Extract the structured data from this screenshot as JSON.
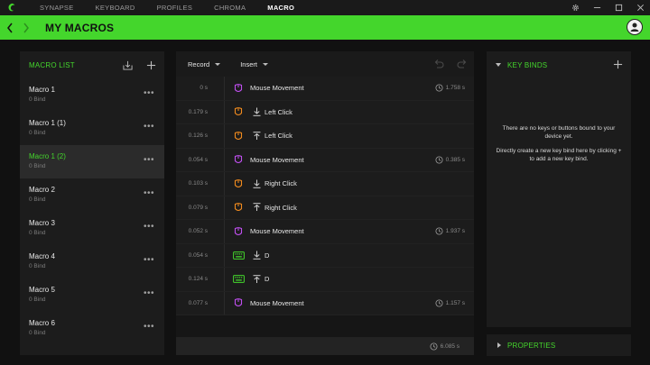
{
  "app": {
    "tabs": [
      "SYNAPSE",
      "KEYBOARD",
      "PROFILES",
      "CHROMA",
      "MACRO"
    ],
    "active_tab": "MACRO",
    "accent_color": "#44d62c"
  },
  "header": {
    "title": "MY MACROS"
  },
  "macro_list": {
    "title": "MACRO LIST",
    "items": [
      {
        "name": "Macro 1",
        "bind": "0 Bind"
      },
      {
        "name": "Macro 1 (1)",
        "bind": "0 Bind"
      },
      {
        "name": "Macro 1 (2)",
        "bind": "0 Bind",
        "selected": true
      },
      {
        "name": "Macro 2",
        "bind": "0 Bind"
      },
      {
        "name": "Macro 3",
        "bind": "0 Bind"
      },
      {
        "name": "Macro 4",
        "bind": "0 Bind"
      },
      {
        "name": "Macro 5",
        "bind": "0 Bind"
      },
      {
        "name": "Macro 6",
        "bind": "0 Bind"
      }
    ]
  },
  "editor": {
    "record_label": "Record",
    "insert_label": "Insert",
    "events": [
      {
        "delay": "0 s",
        "device": "mouse",
        "color": "#c04ff0",
        "direction": "",
        "label": "Mouse Movement",
        "duration": "1.758 s"
      },
      {
        "delay": "0.179 s",
        "device": "mouse",
        "color": "#f28b1e",
        "direction": "down",
        "label": "Left Click",
        "duration": ""
      },
      {
        "delay": "0.126 s",
        "device": "mouse",
        "color": "#f28b1e",
        "direction": "up",
        "label": "Left Click",
        "duration": ""
      },
      {
        "delay": "0.054 s",
        "device": "mouse",
        "color": "#c04ff0",
        "direction": "",
        "label": "Mouse Movement",
        "duration": "0.385 s"
      },
      {
        "delay": "0.103 s",
        "device": "mouse",
        "color": "#f28b1e",
        "direction": "down",
        "label": "Right Click",
        "duration": ""
      },
      {
        "delay": "0.079 s",
        "device": "mouse",
        "color": "#f28b1e",
        "direction": "up",
        "label": "Right Click",
        "duration": ""
      },
      {
        "delay": "0.052 s",
        "device": "mouse",
        "color": "#c04ff0",
        "direction": "",
        "label": "Mouse Movement",
        "duration": "1.937 s"
      },
      {
        "delay": "0.054 s",
        "device": "keyboard",
        "color": "#44d62c",
        "direction": "down",
        "label": "D",
        "duration": ""
      },
      {
        "delay": "0.124 s",
        "device": "keyboard",
        "color": "#44d62c",
        "direction": "up",
        "label": "D",
        "duration": ""
      },
      {
        "delay": "0.077 s",
        "device": "mouse",
        "color": "#c04ff0",
        "direction": "",
        "label": "Mouse Movement",
        "duration": "1.157 s"
      }
    ],
    "total_duration": "6.085 s"
  },
  "key_binds": {
    "title": "KEY BINDS",
    "message_1": "There are no keys or buttons bound to your device yet.",
    "message_2": "Directly create a new key bind here by clicking + to add a new key bind."
  },
  "properties": {
    "title": "PROPERTIES"
  }
}
